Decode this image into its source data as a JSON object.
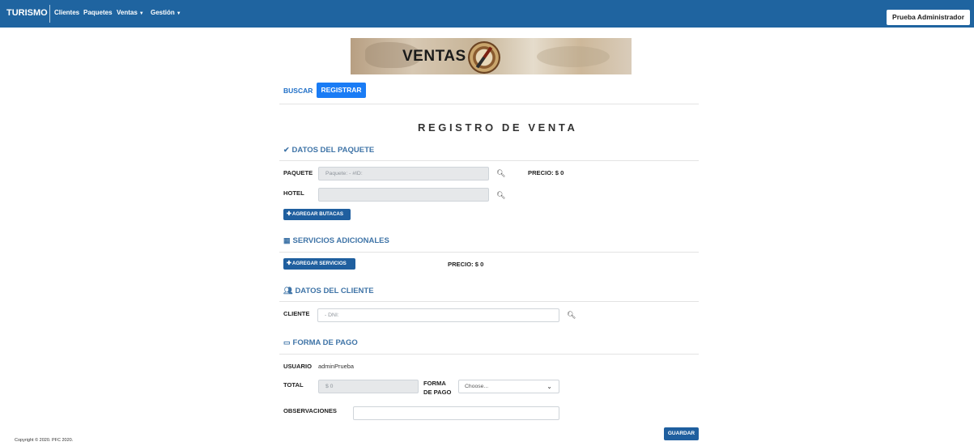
{
  "navbar": {
    "brand": "TURISMO",
    "items": [
      {
        "label": "Clientes",
        "dropdown": false
      },
      {
        "label": "Paquetes",
        "dropdown": false
      },
      {
        "label": "Ventas",
        "dropdown": true
      },
      {
        "label": "Gestión",
        "dropdown": true
      }
    ],
    "user_button": "Prueba Administrador",
    "bg_color": "#1f64a0"
  },
  "banner": {
    "title": "VENTAS"
  },
  "tabs": {
    "buscar": "BUSCAR",
    "registrar": "REGISTRAR",
    "active": "REGISTRAR"
  },
  "page_title": "REGISTRO DE VENTA",
  "sections": {
    "paquete": {
      "title": "DATOS DEL PAQUETE",
      "icon": "check-icon",
      "paquete_label": "PAQUETE",
      "paquete_placeholder": "Paquete:  - #ID:",
      "precio": "PRECIO: $ 0",
      "hotel_label": "HOTEL",
      "hotel_placeholder": "",
      "agregar_butacas": "AGREGAR BUTACAS"
    },
    "servicios": {
      "title": "SERVICIOS ADICIONALES",
      "icon": "map-icon",
      "agregar_servicios": "AGREGAR SERVICIOS",
      "precio": "PRECIO: $ 0"
    },
    "cliente": {
      "title": "DATOS DEL CLIENTE",
      "icon": "users-icon",
      "cliente_label": "CLIENTE",
      "cliente_placeholder": " - DNI:"
    },
    "pago": {
      "title": "FORMA DE PAGO",
      "icon": "credit-card-icon",
      "usuario_label": "USUARIO",
      "usuario_value": "adminPrueba",
      "total_label": "TOTAL",
      "total_value": "$ 0",
      "forma_label_1": "FORMA",
      "forma_label_2": "DE PAGO",
      "forma_selected": "Choose...",
      "observaciones_label": "OBSERVACIONES",
      "observaciones_value": ""
    }
  },
  "guardar_button": "GUARDAR",
  "footer": "Copyright © 2020. PFC 2020.",
  "colors": {
    "accent": "#1a7cf5",
    "section_title": "#3f74a7",
    "small_button": "#1f5f9f"
  }
}
